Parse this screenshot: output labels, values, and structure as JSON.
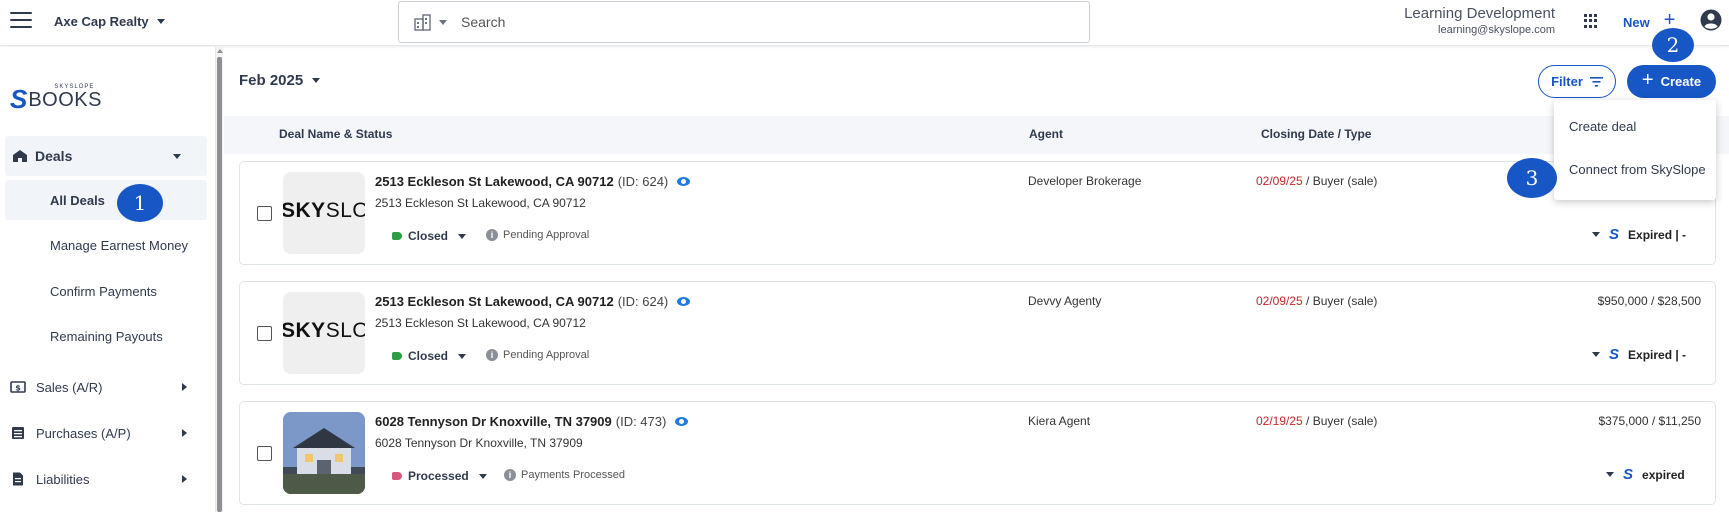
{
  "header": {
    "org_name": "Axe Cap Realty",
    "search_placeholder": "Search",
    "user_name": "Learning Development",
    "user_email": "learning@skyslope.com",
    "new_label": "New"
  },
  "sidebar": {
    "logo_small": "SKYSLOPE",
    "logo_big": "BOOKS",
    "deals_label": "Deals",
    "deals_children": [
      "All Deals",
      "Manage Earnest Money",
      "Confirm Payments",
      "Remaining Payouts"
    ],
    "items": [
      "Sales (A/R)",
      "Purchases (A/P)",
      "Liabilities"
    ]
  },
  "badges": [
    "1",
    "2",
    "3"
  ],
  "main": {
    "month": "Feb 2025",
    "filter_label": "Filter",
    "create_label": "Create",
    "columns": [
      "Deal Name & Status",
      "Agent",
      "Closing Date / Type"
    ],
    "create_menu": [
      "Create deal",
      "Connect from SkySlope"
    ]
  },
  "deals": [
    {
      "name": "2513 Eckleson St Lakewood, CA 90712",
      "id": "(ID: 624)",
      "address": "2513 Eckleson St Lakewood, CA 90712",
      "status": "Closed",
      "status_color": "#2e9e44",
      "sub_status": "Pending Approval",
      "agent": "Developer Brokerage",
      "date": "02/09/25",
      "type": " / Buyer (sale)",
      "price": "",
      "expired": "Expired | -",
      "thumb": "SKYSLOPE"
    },
    {
      "name": "2513 Eckleson St Lakewood, CA 90712",
      "id": "(ID: 624)",
      "address": "2513 Eckleson St Lakewood, CA 90712",
      "status": "Closed",
      "status_color": "#2e9e44",
      "sub_status": "Pending Approval",
      "agent": "Devvy Agenty",
      "date": "02/09/25",
      "type": " / Buyer (sale)",
      "price": "$950,000 / $28,500",
      "expired": "Expired | -",
      "thumb": "SKYSLOPE"
    },
    {
      "name": "6028 Tennyson Dr Knoxville, TN 37909",
      "id": "(ID: 473)",
      "address": "6028 Tennyson Dr Knoxville, TN 37909",
      "status": "Processed",
      "status_color": "#d9577a",
      "sub_status": "Payments Processed",
      "agent": "Kiera Agent",
      "date": "02/19/25",
      "type": " / Buyer (sale)",
      "price": "$375,000 / $11,250",
      "expired": "expired",
      "thumb": "house"
    }
  ],
  "colors": {
    "brand": "#1756c5",
    "date_red": "#c62828"
  }
}
